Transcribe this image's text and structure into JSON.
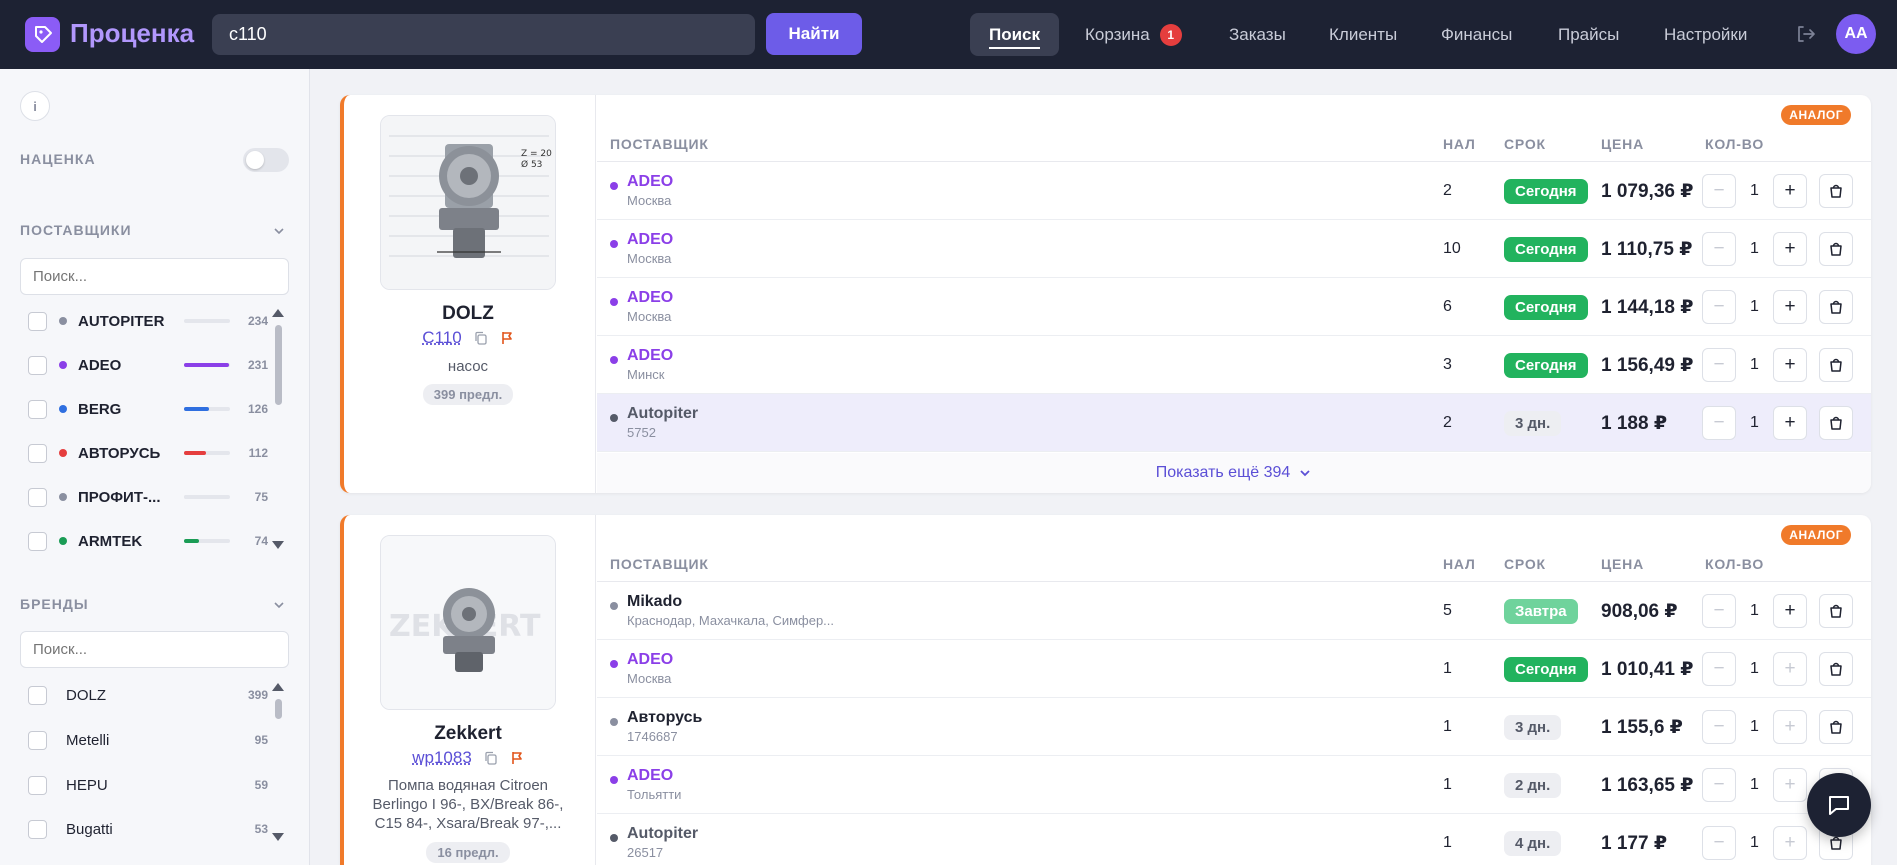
{
  "header": {
    "logo": "Проценка",
    "search_value": "c110",
    "find_label": "Найти",
    "nav": [
      {
        "label": "Поиск"
      },
      {
        "label": "Корзина",
        "badge": "1"
      },
      {
        "label": "Заказы"
      },
      {
        "label": "Клиенты"
      },
      {
        "label": "Финансы"
      },
      {
        "label": "Прайсы"
      },
      {
        "label": "Настройки"
      }
    ],
    "avatar": "AA"
  },
  "sidebar": {
    "markup_label": "НАЦЕНКА",
    "suppliers_title": "ПОСТАВЩИКИ",
    "suppliers_search_placeholder": "Поиск...",
    "suppliers": [
      {
        "name": "AUTOPITER",
        "count": "234",
        "color": "#8a8fa0",
        "fill": 0.0
      },
      {
        "name": "ADEO",
        "count": "231",
        "color": "#8b3fe8",
        "fill": 0.98
      },
      {
        "name": "BERG",
        "count": "126",
        "color": "#2f6fe0",
        "fill": 0.54
      },
      {
        "name": "АВТОРУСЬ",
        "count": "112",
        "color": "#e53e3e",
        "fill": 0.48
      },
      {
        "name": "ПРОФИТ-...",
        "count": "75",
        "color": "#8a8fa0",
        "fill": 0.0
      },
      {
        "name": "ARMTEK",
        "count": "74",
        "color": "#1a9c55",
        "fill": 0.32
      }
    ],
    "brands_title": "БРЕНДЫ",
    "brands_search_placeholder": "Поиск...",
    "brands": [
      {
        "name": "DOLZ",
        "count": "399"
      },
      {
        "name": "Metelli",
        "count": "95"
      },
      {
        "name": "HEPU",
        "count": "59"
      },
      {
        "name": "Bugatti",
        "count": "53"
      }
    ]
  },
  "columns": {
    "supplier": "ПОСТАВЩИК",
    "nal": "НАЛ",
    "srok": "СРОК",
    "price": "ЦЕНА",
    "qty": "КОЛ-ВО"
  },
  "cards": [
    {
      "tag": "АНАЛОГ",
      "brand": "DOLZ",
      "article": "C110",
      "desc": "насос",
      "offers": "399 предл.",
      "rows": [
        {
          "supplier": "ADEO",
          "city": "Москва",
          "nal": "2",
          "srok": "Сегодня",
          "srok_style": "green",
          "price": "1 079,36 ₽",
          "qty": "1",
          "dot": "#8b3fe8",
          "name_color": "#8b3fe8"
        },
        {
          "supplier": "ADEO",
          "city": "Москва",
          "nal": "10",
          "srok": "Сегодня",
          "srok_style": "green",
          "price": "1 110,75 ₽",
          "qty": "1",
          "dot": "#8b3fe8",
          "name_color": "#8b3fe8"
        },
        {
          "supplier": "ADEO",
          "city": "Москва",
          "nal": "6",
          "srok": "Сегодня",
          "srok_style": "green",
          "price": "1 144,18 ₽",
          "qty": "1",
          "dot": "#8b3fe8",
          "name_color": "#8b3fe8"
        },
        {
          "supplier": "ADEO",
          "city": "Минск",
          "nal": "3",
          "srok": "Сегодня",
          "srok_style": "green",
          "price": "1 156,49 ₽",
          "qty": "1",
          "dot": "#8b3fe8",
          "name_color": "#8b3fe8"
        },
        {
          "supplier": "Autopiter",
          "city": "5752",
          "nal": "2",
          "srok": "3 дн.",
          "srok_style": "grey",
          "price": "1 188 ₽",
          "qty": "1",
          "dot": "#555a68",
          "name_color": "#555a68"
        }
      ],
      "show_more": "Показать ещё 394"
    },
    {
      "tag": "АНАЛОГ",
      "brand": "Zekkert",
      "article": "wp1083",
      "desc": "Помпа водяная Citroen Berlingo I 96-, BX/Break 86-, C15 84-, Xsara/Break 97-,...",
      "offers": "16 предл.",
      "rows": [
        {
          "supplier": "Mikado",
          "city": "Краснодар, Махачкала, Симфер...",
          "nal": "5",
          "srok": "Завтра",
          "srok_style": "lgreen",
          "price": "908,06 ₽",
          "qty": "1",
          "dot": "#8a8fa0",
          "name_color": "#1f2230"
        },
        {
          "supplier": "ADEO",
          "city": "Москва",
          "nal": "1",
          "srok": "Сегодня",
          "srok_style": "green",
          "price": "1 010,41 ₽",
          "qty": "1",
          "dot": "#8b3fe8",
          "name_color": "#8b3fe8"
        },
        {
          "supplier": "Авторусь",
          "city": "1746687",
          "nal": "1",
          "srok": "3 дн.",
          "srok_style": "grey",
          "price": "1 155,6 ₽",
          "qty": "1",
          "dot": "#8a8fa0",
          "name_color": "#1f2230"
        },
        {
          "supplier": "ADEO",
          "city": "Тольятти",
          "nal": "1",
          "srok": "2 дн.",
          "srok_style": "grey",
          "price": "1 163,65 ₽",
          "qty": "1",
          "dot": "#8b3fe8",
          "name_color": "#8b3fe8"
        },
        {
          "supplier": "Autopiter",
          "city": "26517",
          "nal": "1",
          "srok": "4 дн.",
          "srok_style": "grey",
          "price": "1 177 ₽",
          "qty": "1",
          "dot": "#555a68",
          "name_color": "#555a68"
        }
      ]
    }
  ]
}
